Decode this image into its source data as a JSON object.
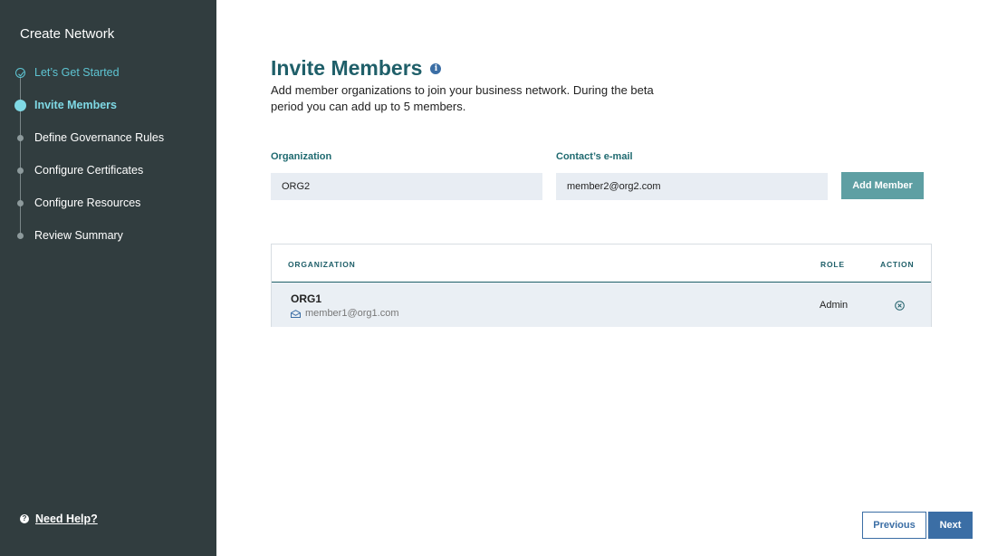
{
  "sidebar": {
    "title": "Create Network",
    "steps": [
      {
        "label": "Let’s Get Started",
        "state": "done"
      },
      {
        "label": "Invite Members",
        "state": "active"
      },
      {
        "label": "Define Governance Rules",
        "state": "pending"
      },
      {
        "label": "Configure Certificates",
        "state": "pending"
      },
      {
        "label": "Configure Resources",
        "state": "pending"
      },
      {
        "label": "Review Summary",
        "state": "pending"
      }
    ],
    "help_label": "Need Help?"
  },
  "main": {
    "title": "Invite Members",
    "description": "Add member organizations to join your business network. During the beta period you can add up to 5 members.",
    "form": {
      "organization_label": "Organization",
      "organization_value": "ORG2",
      "email_label": "Contact’s e-mail",
      "email_value": "member2@org2.com",
      "add_button_label": "Add Member"
    },
    "table": {
      "headers": {
        "organization": "ORGANIZATION",
        "role": "ROLE",
        "action": "ACTION"
      },
      "rows": [
        {
          "organization": "ORG1",
          "email": "member1@org1.com",
          "role": "Admin"
        }
      ]
    },
    "footer": {
      "previous_label": "Previous",
      "next_label": "Next"
    }
  },
  "colors": {
    "sidebar_bg": "#313d3f",
    "accent_teal": "#5ec5d3",
    "title_teal": "#1f5f69",
    "button_blue": "#3b6ea5",
    "add_button_bg": "#5e9fa3"
  }
}
